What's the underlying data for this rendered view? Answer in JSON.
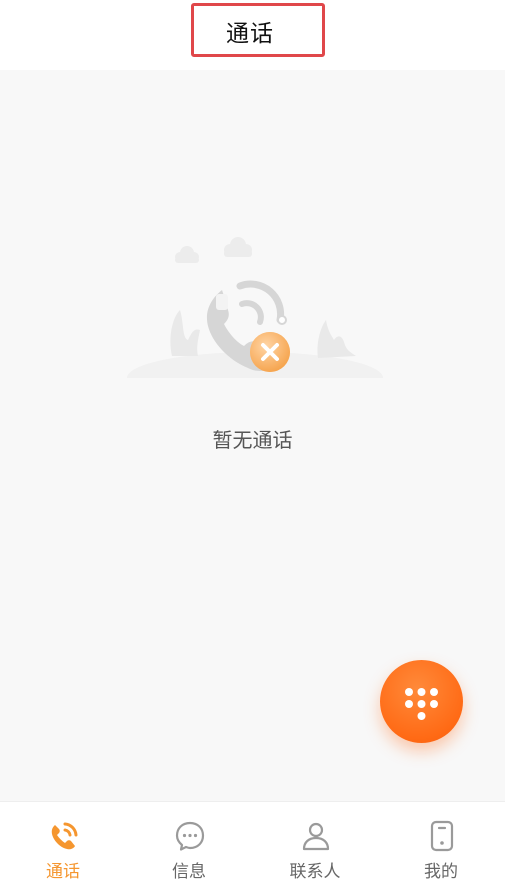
{
  "header": {
    "title": "通话"
  },
  "empty_state": {
    "message": "暂无通话",
    "icon": "no-calls-illustration"
  },
  "fab": {
    "icon": "dialpad-icon",
    "color": "#ff6a15"
  },
  "tabbar": {
    "active_color": "#f5962f",
    "inactive_color": "#999999",
    "tabs": [
      {
        "label": "通话",
        "icon": "phone-icon",
        "active": true
      },
      {
        "label": "信息",
        "icon": "message-icon",
        "active": false
      },
      {
        "label": "联系人",
        "icon": "contact-icon",
        "active": false
      },
      {
        "label": "我的",
        "icon": "mobile-icon",
        "active": false
      }
    ]
  }
}
